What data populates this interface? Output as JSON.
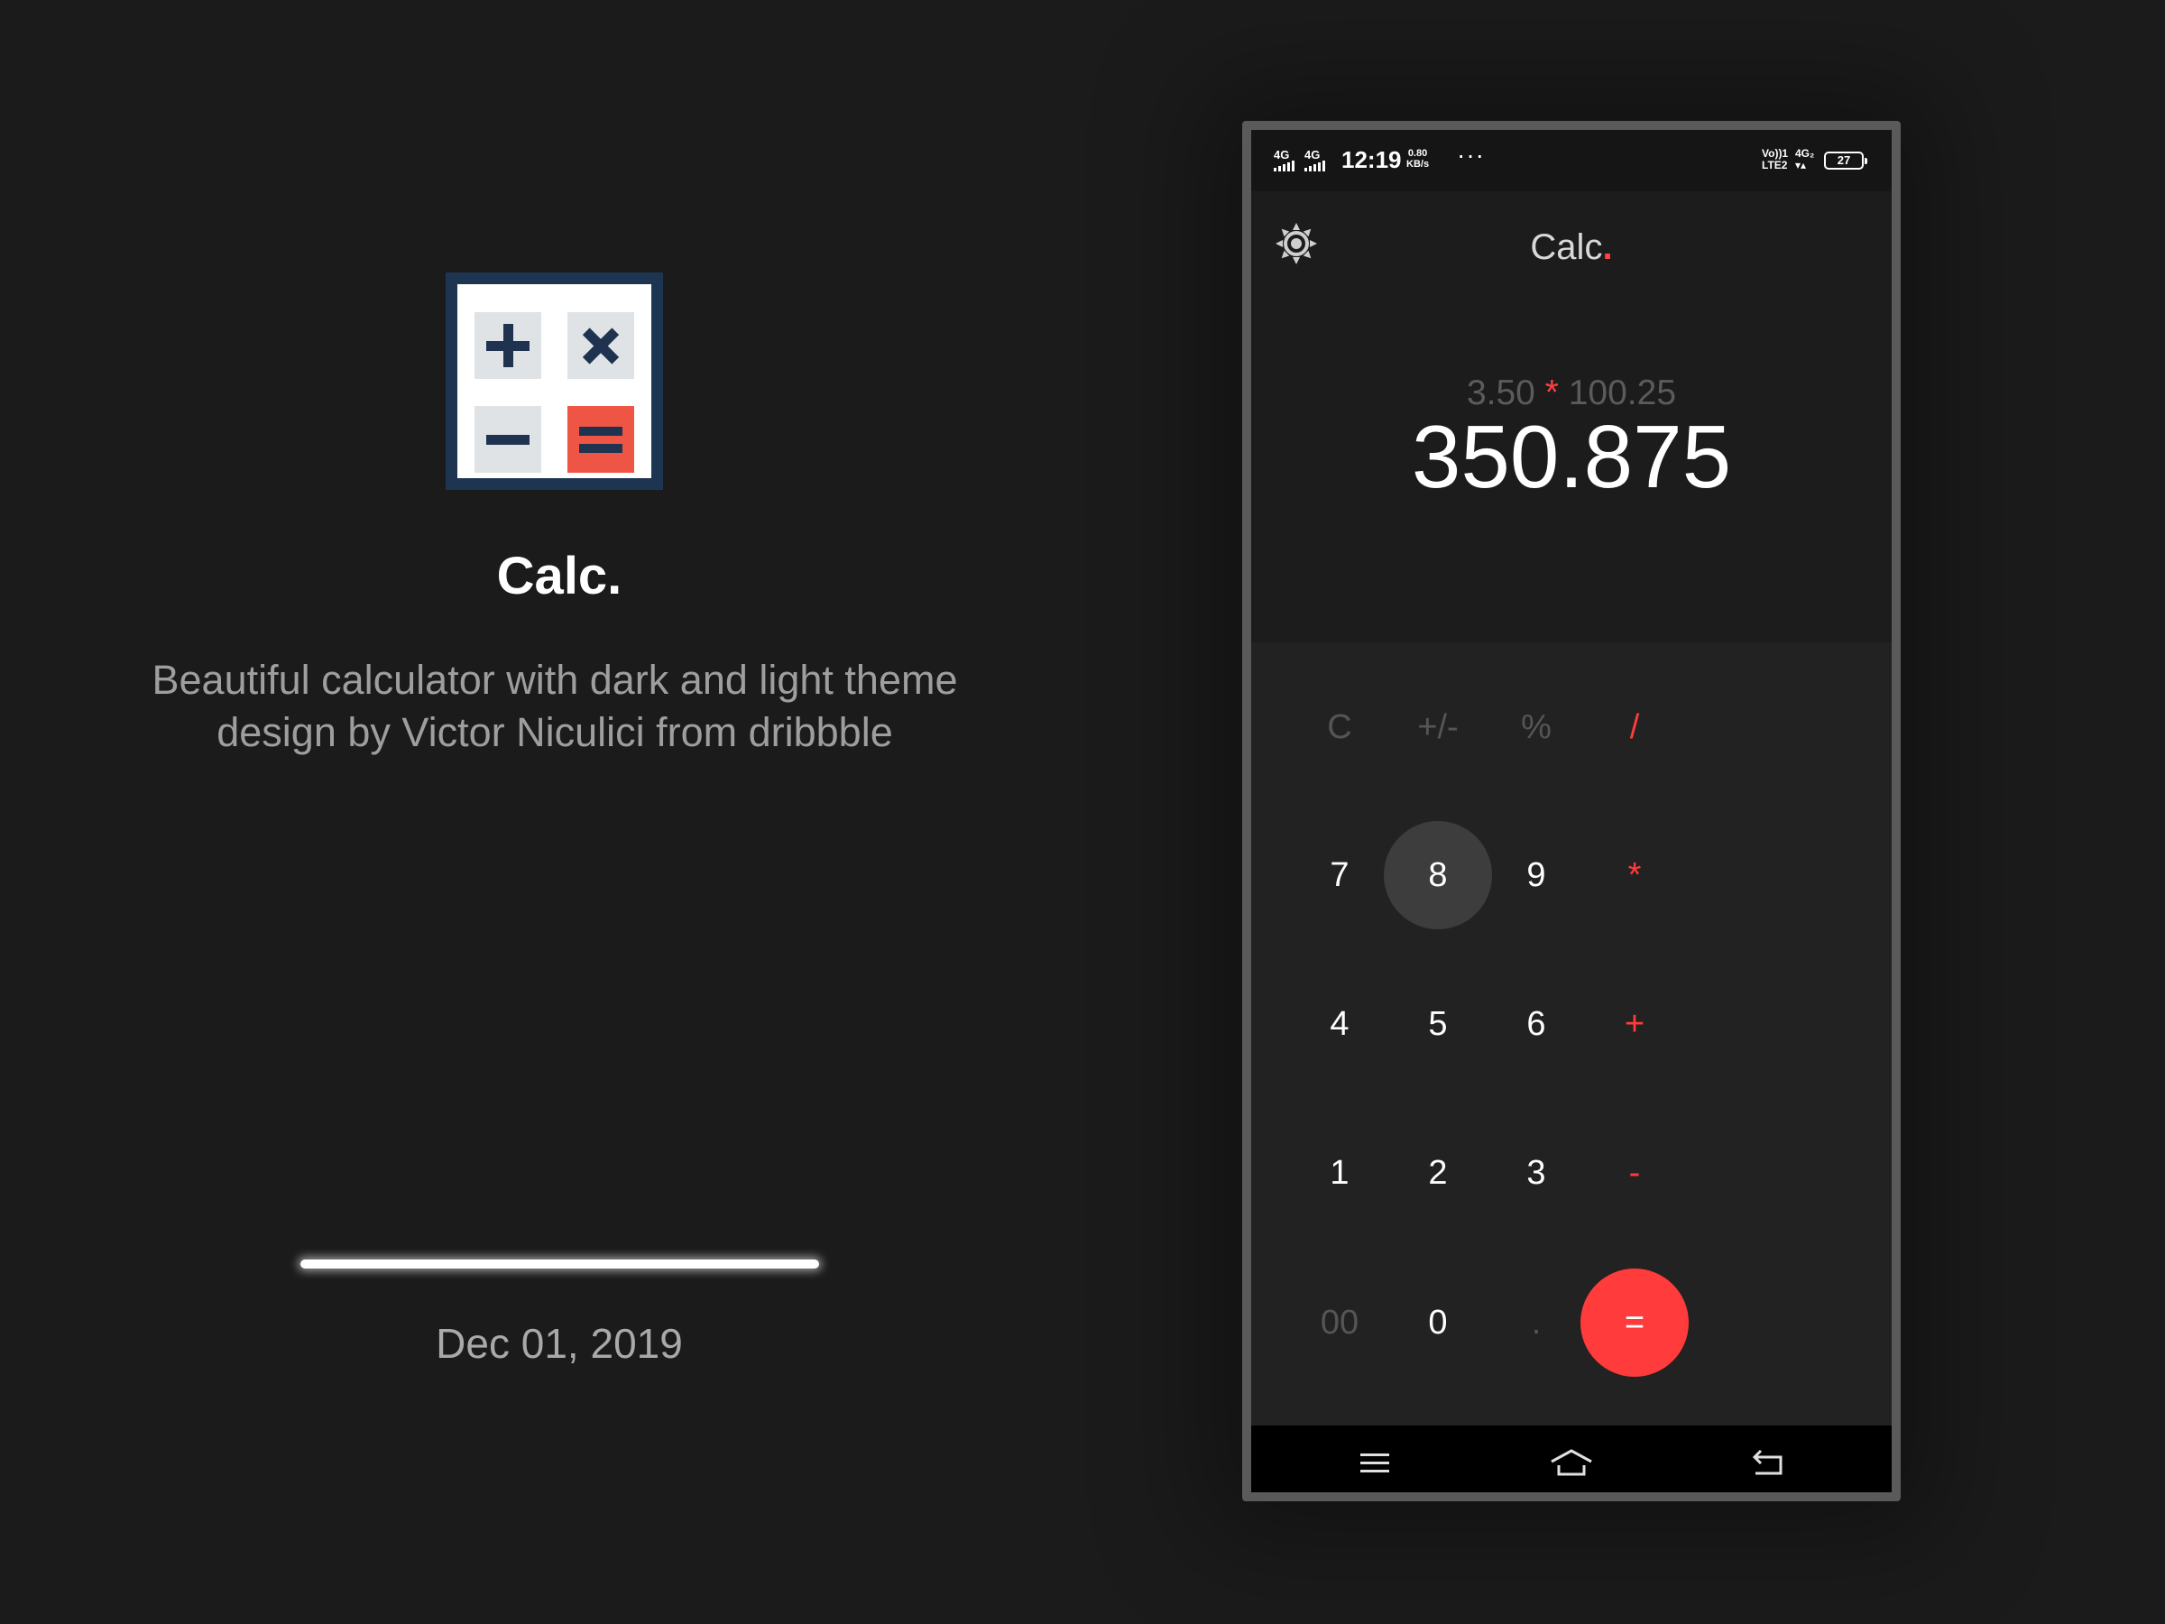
{
  "promo": {
    "title": "Calc.",
    "description_line1": "Beautiful calculator with dark and light theme",
    "description_line2": "design by Victor Niculici from dribbble",
    "date": "Dec 01, 2019",
    "logo_icon": "calculator-logo-icon"
  },
  "status_bar": {
    "sim1_label": "4G",
    "sim2_label": "4G",
    "time": "12:19",
    "speed_value": "0.80",
    "speed_unit": "KB/s",
    "more": "···",
    "volte_line1": "Vo))1",
    "volte_line2": "LTE2",
    "network_line1": "4G₂",
    "network_line2": "▾▴",
    "battery": "27"
  },
  "app": {
    "title": "Calc",
    "title_dot": ".",
    "theme_icon": "sun-icon"
  },
  "display": {
    "operand1": "3.50",
    "operator": "*",
    "operand2": "100.25",
    "result": "350.875"
  },
  "keypad": {
    "rows": [
      [
        "C",
        "+/-",
        "%",
        "/"
      ],
      [
        "7",
        "8",
        "9",
        "*"
      ],
      [
        "4",
        "5",
        "6",
        "+"
      ],
      [
        "1",
        "2",
        "3",
        "-"
      ],
      [
        "00",
        "0",
        ".",
        "="
      ]
    ],
    "pressed_key": "8"
  },
  "nav_bar": {
    "icons": [
      "menu-icon",
      "home-icon",
      "back-icon"
    ]
  },
  "colors": {
    "background": "#1b1b1b",
    "accent": "#ff3b3b",
    "logo_frame": "#1e3552",
    "logo_equals": "#ee5545"
  }
}
